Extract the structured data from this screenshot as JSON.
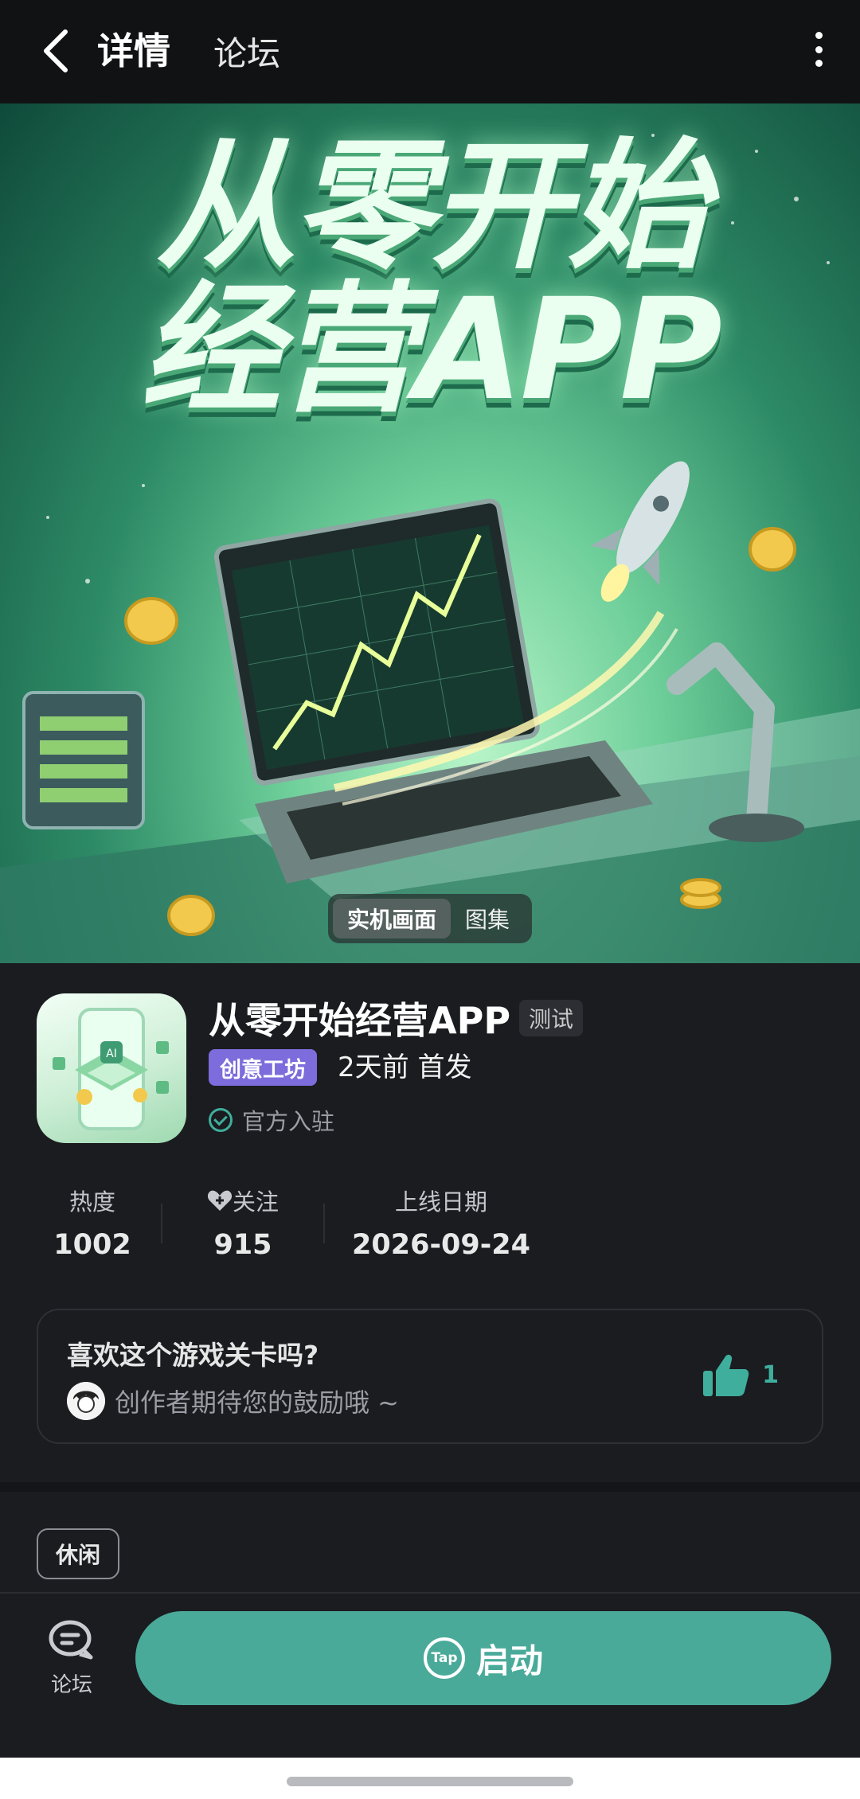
{
  "header": {
    "tab_active": "详情",
    "tab_other": "论坛"
  },
  "hero": {
    "title_line1": "从零开始",
    "title_line2": "经营APP",
    "segment": [
      "实机画面",
      "图集"
    ]
  },
  "app": {
    "name": "从零开始经营APP",
    "badge": "测试",
    "category_tag": "创意工坊",
    "release_text": "2天前 首发",
    "official_text": "官方入驻",
    "icon_text": "AI"
  },
  "stats": [
    {
      "label": "热度",
      "value": "1002"
    },
    {
      "label": "关注",
      "value": "915"
    },
    {
      "label": "上线日期",
      "value": "2026-09-24"
    }
  ],
  "like_card": {
    "question": "喜欢这个游戏关卡吗?",
    "subtitle": "创作者期待您的鼓励哦 ~",
    "like_count": "1"
  },
  "tags": [
    "休闲"
  ],
  "bottom": {
    "forum_label": "论坛",
    "launch_label": "启动",
    "tap_logo_text": "Tap"
  },
  "colors": {
    "accent": "#4aaa9a",
    "workshop_badge": "#7c6cdc",
    "background": "#1b1c20"
  }
}
